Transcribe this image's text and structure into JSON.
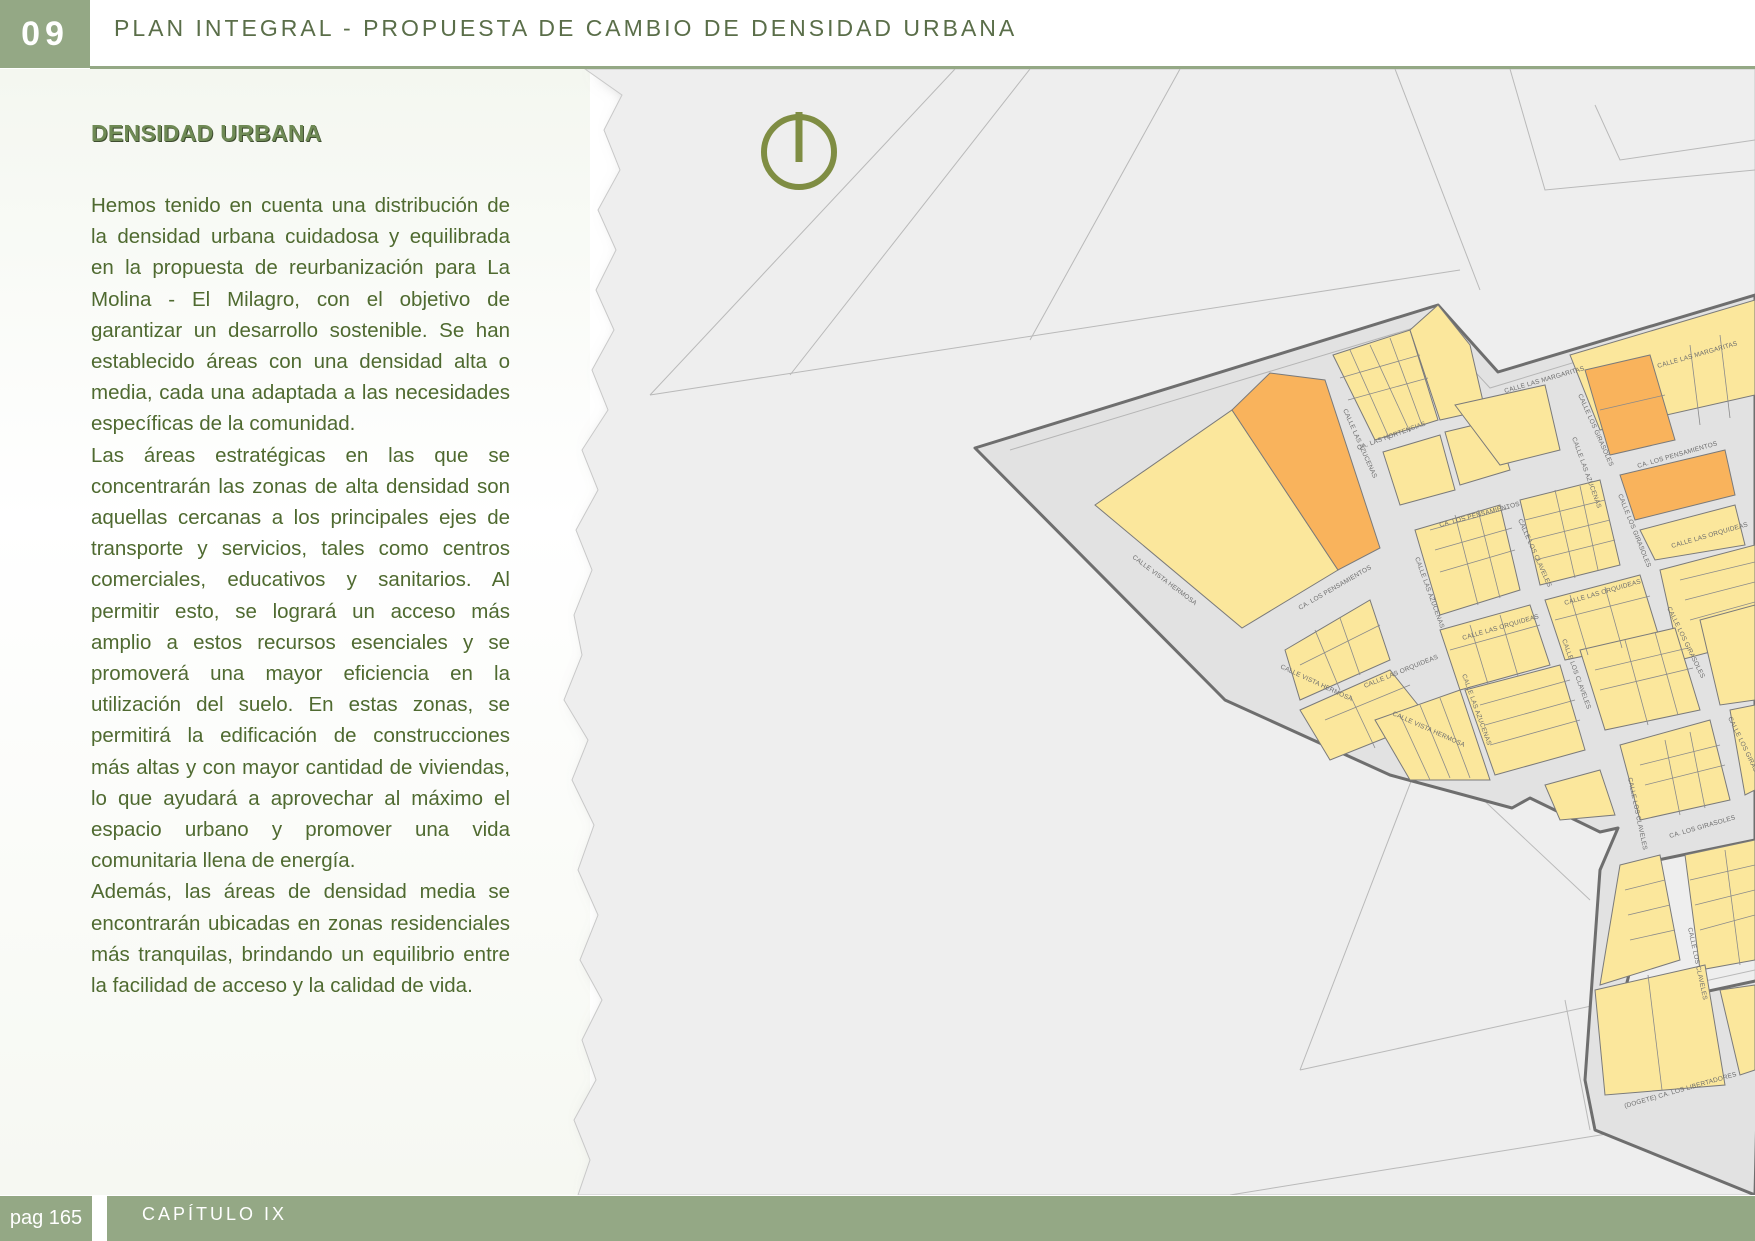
{
  "header": {
    "chapter_number": "09",
    "title": "PLAN INTEGRAL - PROPUESTA DE CAMBIO DE DENSIDAD URBANA"
  },
  "section": {
    "title": "DENSIDAD URBANA",
    "paragraphs": [
      "Hemos tenido en cuenta una distribución de la densidad urbana cuidadosa y equilibrada en la propuesta de reurbanización para La Molina - El Milagro, con el objetivo de garantizar un desarrollo sostenible. Se han establecido áreas con una densidad alta o media, cada una adaptada a las necesidades específicas de la comunidad.",
      "Las áreas estratégicas en las que se concentrarán las zonas de alta densidad son aquellas cercanas a los principales ejes de transporte y servicios, tales como centros comerciales, educativos y sanitarios. Al permitir esto, se logrará un acceso más amplio a estos recursos esenciales y se promoverá una mayor eficiencia en la utilización del suelo. En estas zonas, se permitirá la edificación de construcciones más altas y con mayor cantidad de viviendas, lo que ayudará a aprovechar al máximo el espacio urbano y promover una vida comunitaria llena de energía.",
      "Además, las áreas de densidad media se encontrarán ubicadas en zonas residenciales más tranquilas, brindando un equilibrio entre la facilidad de acceso y la calidad de vida."
    ]
  },
  "map": {
    "colors": {
      "paper": "#eeeeee",
      "medium_density": "#fbe79c",
      "high_density": "#f9b35c",
      "road": "#e2e2e2",
      "boundary": "#6e6e6e",
      "north_symbol": "#7f8d43"
    },
    "north_icon": "north-arrow-icon",
    "streets": {
      "margaritas": "CALLE LAS MARGARITAS",
      "margaritas_2": "CALLE LAS MARGARITAS",
      "hortensias": "CA. LAS HORTENSIAS",
      "azucenas": "CALLE LAS AZUCENAS",
      "girasoles": "CALLE LOS GIRASOLES",
      "pensamientos": "CA. LOS PENSAMIENTOS",
      "pensamientos_2": "CA. LOS PENSAMIENTOS",
      "pensamientos_3": "CA. LOS PENSAMIENTOS",
      "claveles": "CALLE LOS CLAVELES",
      "orquideas": "CALLE LAS ORQUIDEAS",
      "orquideas_2": "CALLE LAS ORQUIDEAS",
      "orquideas_3": "CALLE LAS ORQUIDEAS",
      "orquideas_4": "CALLE LAS ORQUIDEAS",
      "vista_hermosa": "CALLE VISTA HERMOSA",
      "vista_hermosa_2": "CALLE VISTA HERMOSA",
      "vista_hermosa_3": "CALLE VISTA HERMOSA",
      "azucenas_2": "CALLE LAS AZUCENAS",
      "azucenas_3": "CALLE LAS AZUCENAS",
      "azucenas_4": "CALLE LAS AZUCENAS",
      "girasoles_2": "CALLE LOS GIRASOLES",
      "girasoles_3": "CALLE LOS GIRASOLES",
      "girasoles_4": "CALLE LOS GIRASOLES",
      "claveles_2": "CALLE LOS CLAVELES",
      "claveles_3": "CALLE LOS CLAVELES",
      "claveles_4": "CALLE LOS CLAVELES",
      "girasoles_ca": "CA. LOS GIRASOLES",
      "libertadores": "(DOGETE) CA. LOS LIBERTADORES"
    }
  },
  "footer": {
    "page_label": "pag 165",
    "chapter_label": "CAPÍTULO IX"
  }
}
